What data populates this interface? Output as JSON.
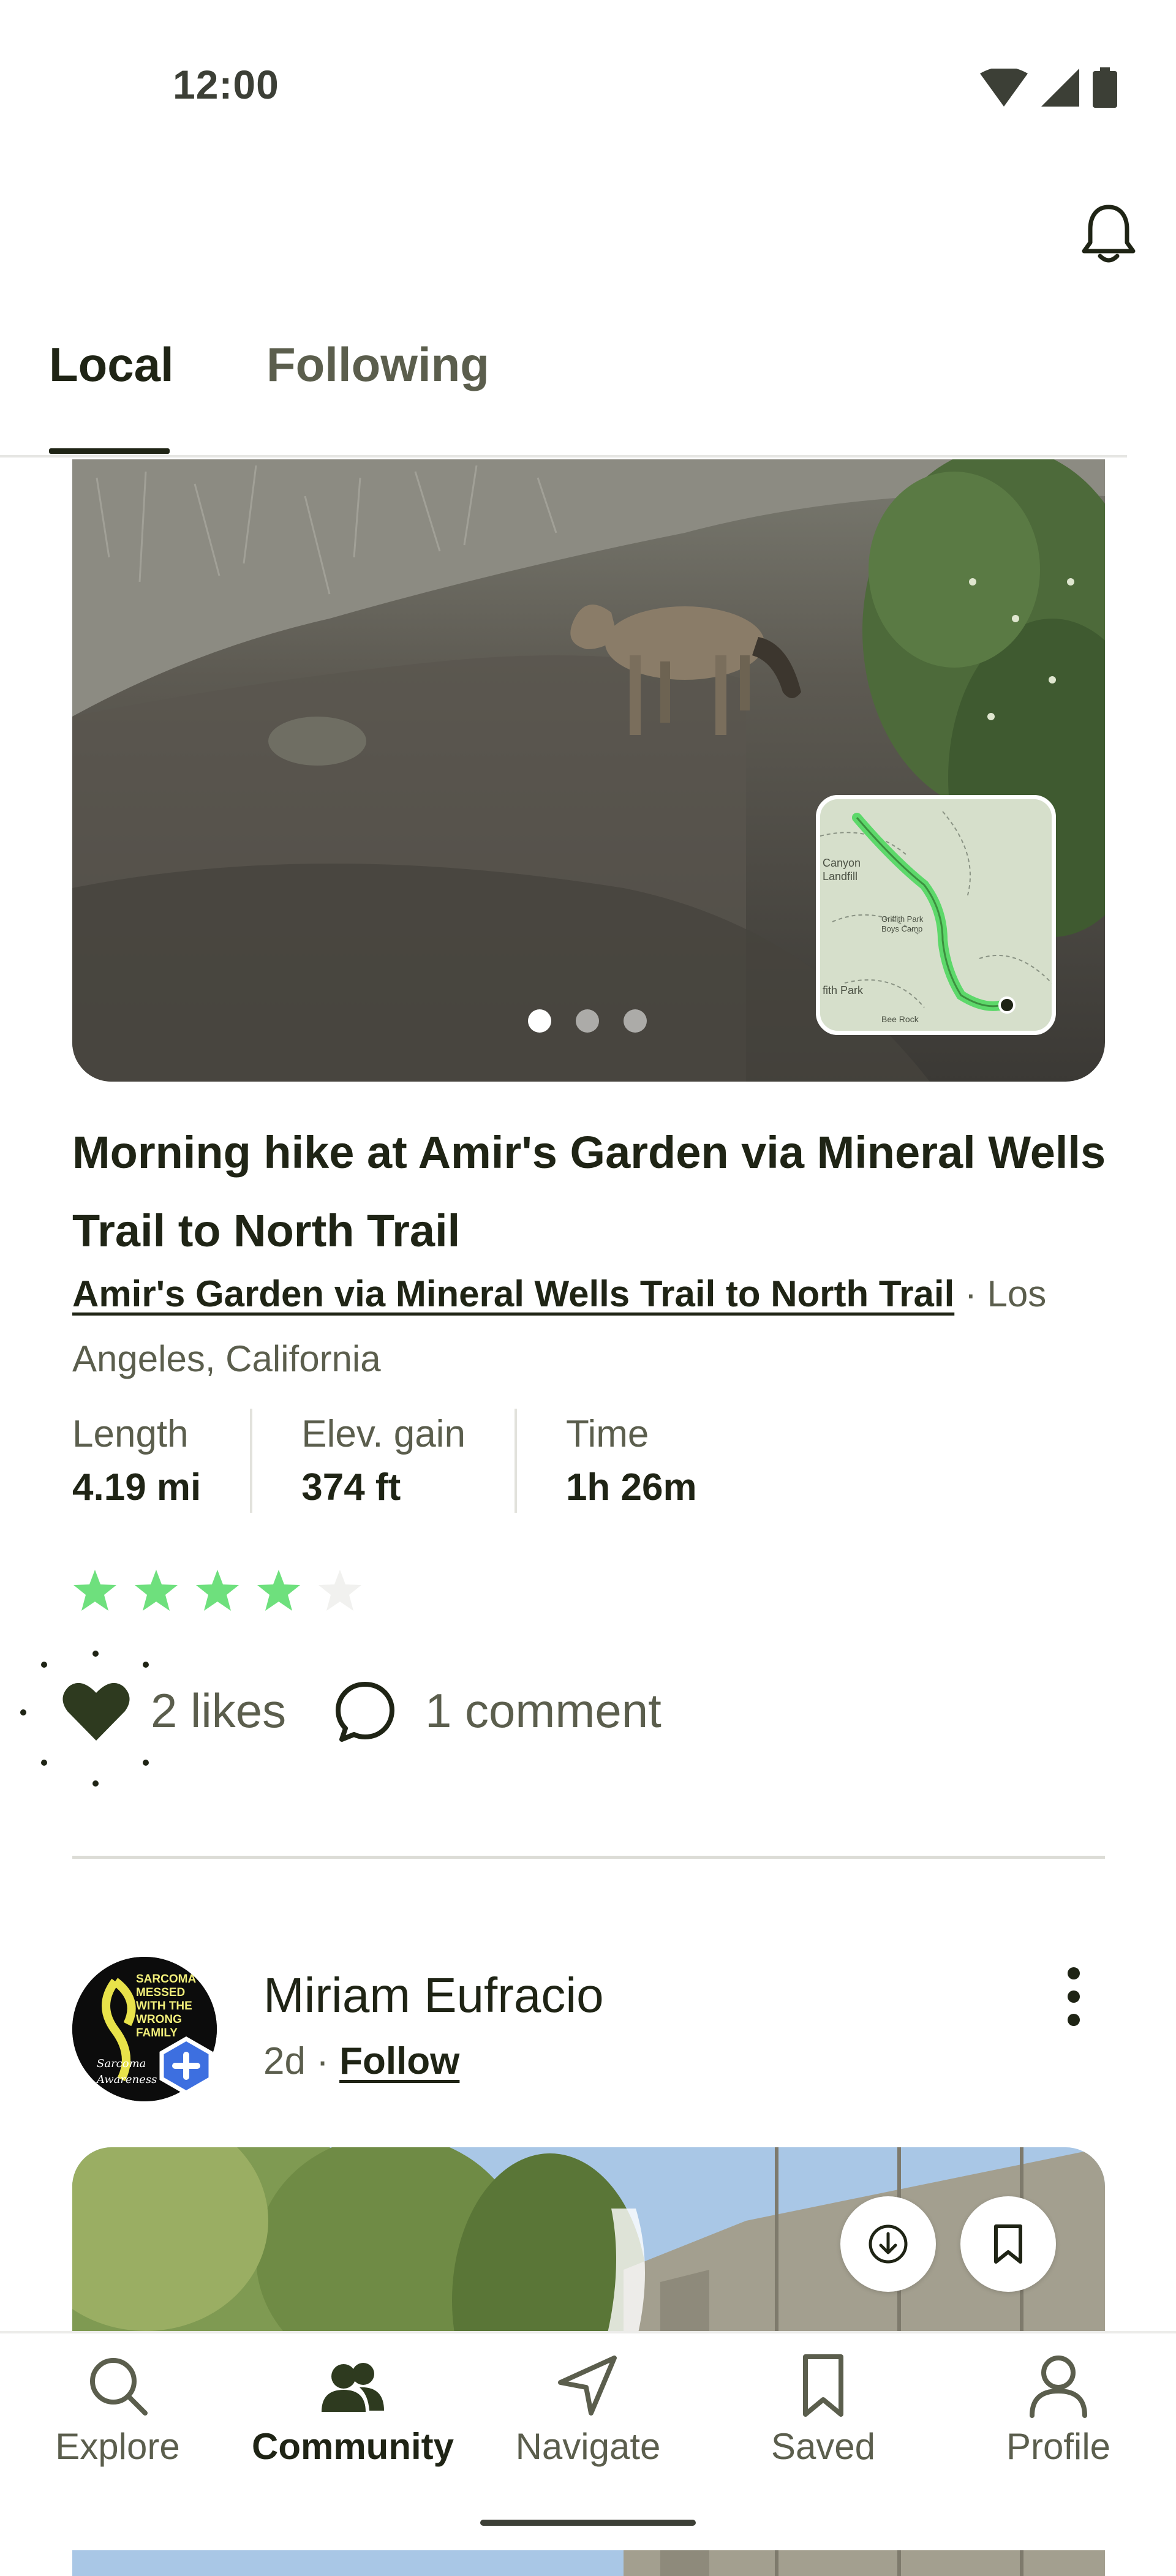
{
  "status_bar": {
    "time": "12:00",
    "icons": [
      "wifi-icon",
      "signal-icon",
      "battery-icon"
    ]
  },
  "header": {
    "notification_icon": "bell-icon",
    "tabs": [
      {
        "label": "Local",
        "active": true
      },
      {
        "label": "Following",
        "active": false
      }
    ]
  },
  "activity": {
    "photo_count": 3,
    "active_photo": 1,
    "title": "Morning hike at Amir's Garden via Mineral Wells Trail to North Trail",
    "trail_name": "Amir's Garden via Mineral Wells Trail to North Trail",
    "separator": " · ",
    "location": "Los Angeles, California",
    "stats": [
      {
        "label": "Length",
        "value": "4.19 mi"
      },
      {
        "label": "Elev. gain",
        "value": "374 ft"
      },
      {
        "label": "Time",
        "value": "1h 26m"
      }
    ],
    "rating": 4,
    "rating_max": 5,
    "likes": "2 likes",
    "comments": "1 comment",
    "map_labels": {
      "canyon": "Canyon",
      "landfill": "Landfill",
      "griffith": "Griffith Park",
      "boys_camp": "Boys Camp",
      "fith_park": "fith Park",
      "bee_rock": "Bee Rock"
    }
  },
  "next_post": {
    "author": "Miriam Eufracio",
    "time": "2d",
    "separator": " · ",
    "follow_label": "Follow",
    "avatar_text": [
      "SARCOMA",
      "MESSED",
      "WITH THE",
      "WRONG",
      "FAMILY",
      "Sarcoma",
      "Awareness"
    ]
  },
  "bottom_nav": [
    {
      "label": "Explore",
      "icon": "search-icon",
      "active": false
    },
    {
      "label": "Community",
      "icon": "community-icon",
      "active": true
    },
    {
      "label": "Navigate",
      "icon": "navigate-icon",
      "active": false
    },
    {
      "label": "Saved",
      "icon": "bookmark-icon",
      "active": false
    },
    {
      "label": "Profile",
      "icon": "profile-icon",
      "active": false
    }
  ],
  "colors": {
    "accent_green": "#6ee07d",
    "text_dark": "#1f2415",
    "text_muted": "#5b5e4d"
  }
}
